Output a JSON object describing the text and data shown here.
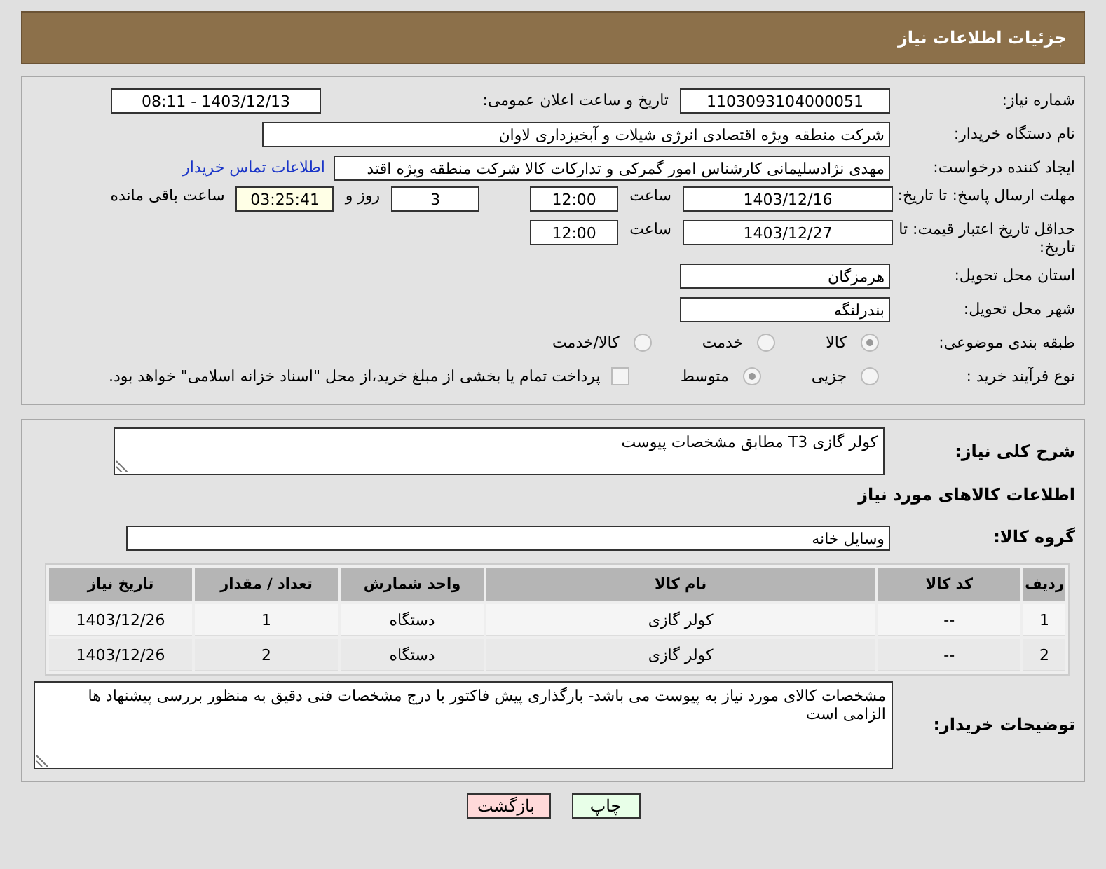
{
  "header": {
    "title": "جزئیات اطلاعات نیاز"
  },
  "details": {
    "need_number": {
      "label": "شماره نیاز:",
      "value": "1103093104000051"
    },
    "announce": {
      "label": "تاریخ و ساعت اعلان عمومی:",
      "value": "1403/12/13 - 08:11"
    },
    "buyer_org": {
      "label": "نام دستگاه خریدار:",
      "value": "شرکت منطقه ویژه اقتصادی انرژی شیلات و آبخیزداری لاوان"
    },
    "requester": {
      "label": "ایجاد کننده درخواست:",
      "value": "مهدی نژادسلیمانی کارشناس امور گمرکی و تدارکات کالا شرکت منطقه ویژه اقتد",
      "link": "اطلاعات تماس خریدار"
    },
    "deadline": {
      "label": "مهلت ارسال پاسخ: تا تاریخ:",
      "date": "1403/12/16",
      "time_label": "ساعت",
      "time": "12:00",
      "days": "3",
      "days_label": "روز و",
      "remaining": "03:25:41",
      "remaining_label": "ساعت باقی مانده"
    },
    "validity": {
      "label": "حداقل تاریخ اعتبار قیمت: تا تاریخ:",
      "date": "1403/12/27",
      "time_label": "ساعت",
      "time": "12:00"
    },
    "province": {
      "label": "استان محل تحویل:",
      "value": "هرمزگان"
    },
    "city": {
      "label": "شهر محل تحویل:",
      "value": "بندرلنگه"
    },
    "category": {
      "label": "طبقه بندی موضوعی:",
      "options": [
        {
          "label": "کالا",
          "selected": true
        },
        {
          "label": "خدمت",
          "selected": false
        },
        {
          "label": "کالا/خدمت",
          "selected": false
        }
      ]
    },
    "process": {
      "label": "نوع فرآیند خرید :",
      "options": [
        {
          "label": "جزیی",
          "selected": false
        },
        {
          "label": "متوسط",
          "selected": true
        }
      ],
      "treasury": {
        "label": "پرداخت تمام یا بخشی از مبلغ خرید،از محل \"اسناد خزانه اسلامی\" خواهد بود.",
        "checked": false
      }
    }
  },
  "description": {
    "label": "شرح کلی نیاز:",
    "value": "کولر گازی T3 مطابق مشخصات پیوست"
  },
  "goods_title": "اطلاعات کالاهای مورد نیاز",
  "goods_group": {
    "label": "گروه کالا:",
    "value": "وسایل خانه"
  },
  "table": {
    "columns": [
      "ردیف",
      "کد کالا",
      "نام کالا",
      "واحد شمارش",
      "تعداد / مقدار",
      "تاریخ نیاز"
    ],
    "rows": [
      [
        "1",
        "--",
        "کولر گازی",
        "دستگاه",
        "1",
        "1403/12/26"
      ],
      [
        "2",
        "--",
        "کولر گازی",
        "دستگاه",
        "2",
        "1403/12/26"
      ]
    ]
  },
  "buyer_notes": {
    "label": "توضیحات خریدار:",
    "value": "مشخصات کالای مورد نیاز به پیوست می باشد- بارگذاری پیش فاکتور با درج مشخصات فنی دقیق به منظور بررسی پیشنهاد ها الزامی است"
  },
  "buttons": [
    {
      "label": "چاپ",
      "kind": "print"
    },
    {
      "label": "بازگشت",
      "kind": "back"
    }
  ]
}
